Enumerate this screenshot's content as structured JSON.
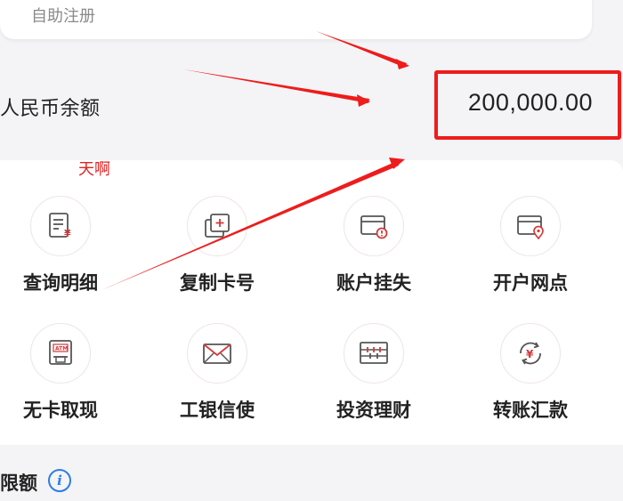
{
  "header": {
    "register_label": "自助注册"
  },
  "balance": {
    "label": "人民币余额",
    "amount": "200,000.00"
  },
  "annotation": {
    "text": "天啊",
    "color": "#e32323"
  },
  "actions": [
    {
      "label": "查询明细",
      "icon": "statement-icon"
    },
    {
      "label": "复制卡号",
      "icon": "copy-card-icon"
    },
    {
      "label": "账户挂失",
      "icon": "report-loss-icon"
    },
    {
      "label": "开户网点",
      "icon": "branch-location-icon"
    },
    {
      "label": "无卡取现",
      "icon": "atm-icon"
    },
    {
      "label": "工银信使",
      "icon": "mail-icon"
    },
    {
      "label": "投资理财",
      "icon": "abacus-icon"
    },
    {
      "label": "转账汇款",
      "icon": "transfer-icon"
    }
  ],
  "limit": {
    "label": "限额",
    "info_icon": "info-icon"
  },
  "colors": {
    "accent": "#d23a3a",
    "annotation": "#ee1c1c",
    "info": "#2b7de9"
  }
}
